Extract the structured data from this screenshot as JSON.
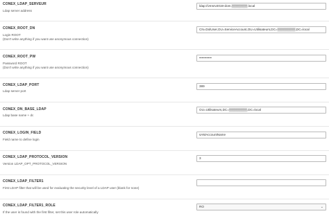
{
  "settings": [
    {
      "name": "CONEX_LDAP_SERVEUR",
      "desc": [
        "Ldap server address"
      ],
      "value": "ldap://vmsrv2019-dom.▒▒▒▒▒▒▒.local",
      "type": "text"
    },
    {
      "name": "CONEX_ROOT_DN",
      "desc": [
        "Login ROOT",
        "(Don't write anything if you want use anonymous connection)"
      ],
      "value": "CN=DolUser,OU=ServiceAccount,OU=Utilisateurs,DC=▒▒▒▒▒▒▒▒,DC=local",
      "type": "text"
    },
    {
      "name": "CONEX_ROOT_PW",
      "desc": [
        "Password ROOT",
        "(Don't write anything if you want use anonymous connection)"
      ],
      "value": "••••••••••",
      "type": "password"
    },
    {
      "name": "CONEX_LDAP_PORT",
      "desc": [
        "Ldap server port"
      ],
      "value": "389",
      "type": "text"
    },
    {
      "name": "CONEX_DN_BASE_LDAP",
      "desc": [
        "Ldap base name + dc"
      ],
      "value": "OU=Utilisateurs,DC=▒▒▒▒▒▒▒▒,DC=local",
      "type": "text"
    },
    {
      "name": "CONEX_LOGIN_FIELD",
      "desc": [
        "Field name to define login"
      ],
      "value": "sAMAccountName",
      "type": "text"
    },
    {
      "name": "CONEX_LDAP_PROTOCOL_VERSION",
      "desc": [
        "Version LDAP_OPT_PROTOCOL_VERSION"
      ],
      "value": "3",
      "type": "text"
    },
    {
      "name": "CONEX_LDAP_FILTER1",
      "desc": [
        "First LDAP filter that will be used for evaluating the security level of a LDAP user (blank for none)"
      ],
      "value": "",
      "type": "text"
    },
    {
      "name": "CONEX_LDAP_FILTER1_ROLE",
      "desc": [
        "If the user is found with the first filter, set this user role automatically"
      ],
      "value": "RO",
      "type": "select"
    }
  ],
  "icons": {
    "select_arrow": "chevron-down-icon"
  }
}
